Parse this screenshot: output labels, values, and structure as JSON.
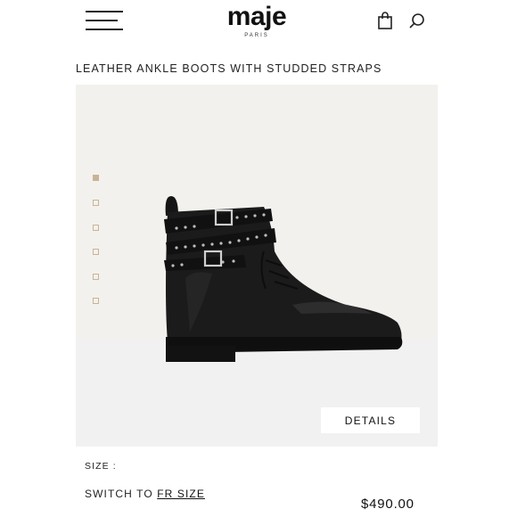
{
  "header": {
    "logo": "maje",
    "logo_sub": "PARIS",
    "menu_icon": "hamburger-menu-icon",
    "bag_icon": "shopping-bag-icon",
    "search_icon": "search-icon"
  },
  "product": {
    "title": "LEATHER ANKLE BOOTS WITH STUDDED STRAPS",
    "details_label": "DETAILS",
    "size_label": "SIZE :",
    "switch_prefix": "SWITCH TO ",
    "switch_link": "FR SIZE",
    "price": "$490.00"
  },
  "gallery": {
    "thumbnail_count": 6,
    "active_index": 0,
    "accent_color": "#c9b397"
  }
}
